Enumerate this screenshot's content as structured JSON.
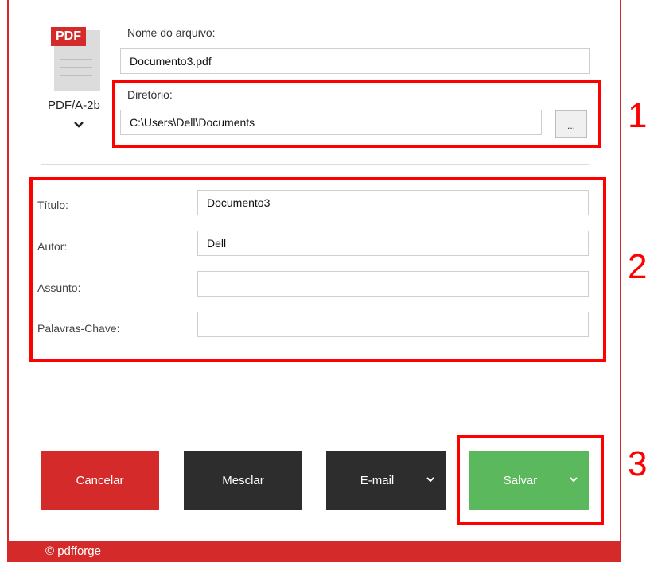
{
  "profile": {
    "badge_text": "PDF",
    "name": "PDF/A-2b"
  },
  "file": {
    "name_label": "Nome do arquivo:",
    "name_value": "Documento3.pdf",
    "directory_label": "Diretório:",
    "directory_value": "C:\\Users\\Dell\\Documents",
    "browse_label": "..."
  },
  "metadata": {
    "title_label": "Título:",
    "title_value": "Documento3",
    "author_label": "Autor:",
    "author_value": "Dell",
    "subject_label": "Assunto:",
    "subject_value": "",
    "keywords_label": "Palavras-Chave:",
    "keywords_value": ""
  },
  "buttons": {
    "cancel": "Cancelar",
    "merge": "Mesclar",
    "email": "E-mail",
    "save": "Salvar"
  },
  "footer": {
    "text": "© pdfforge"
  },
  "annotations": {
    "n1": "1",
    "n2": "2",
    "n3": "3"
  },
  "colors": {
    "brand_red": "#d42a2a",
    "save_green": "#5cb85c",
    "dark_button": "#2d2d2d",
    "annotation_red": "#ff0000"
  },
  "icons": [
    "pdf-file-icon",
    "chevron-down-icon"
  ]
}
